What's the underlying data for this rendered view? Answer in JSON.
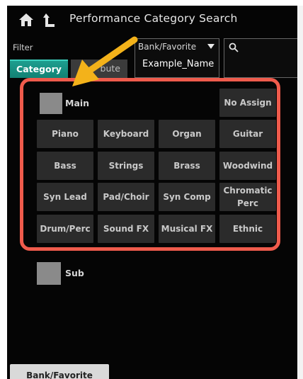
{
  "header": {
    "title": "Performance Category Search",
    "home_icon": "home-icon",
    "up_icon": "up-level-icon"
  },
  "filter": {
    "label": "Filter",
    "tabs": [
      "Category",
      "Attribute"
    ],
    "tab_partial_visible": "bute"
  },
  "bank": {
    "label": "Bank/Favorite",
    "value": "Example_Name"
  },
  "search": {
    "icon": "search-icon"
  },
  "main_category": {
    "label": "Main",
    "checked": false
  },
  "categories": [
    [
      "",
      "",
      "",
      "No Assign"
    ],
    [
      "Piano",
      "Keyboard",
      "Organ",
      "Guitar"
    ],
    [
      "Bass",
      "Strings",
      "Brass",
      "Woodwind"
    ],
    [
      "Syn Lead",
      "Pad/Choir",
      "Syn Comp",
      "Chromatic Perc"
    ],
    [
      "Drum/Perc",
      "Sound FX",
      "Musical FX",
      "Ethnic"
    ]
  ],
  "sub_category": {
    "label": "Sub",
    "checked": false
  },
  "bottom_tab": {
    "label": "Bank/Favorite"
  },
  "colors": {
    "background": "#050505",
    "tab_active": "#1d9e8f",
    "highlight": "#ef5b4c",
    "arrow": "#f3b21a",
    "button": "#2b2b2b"
  }
}
